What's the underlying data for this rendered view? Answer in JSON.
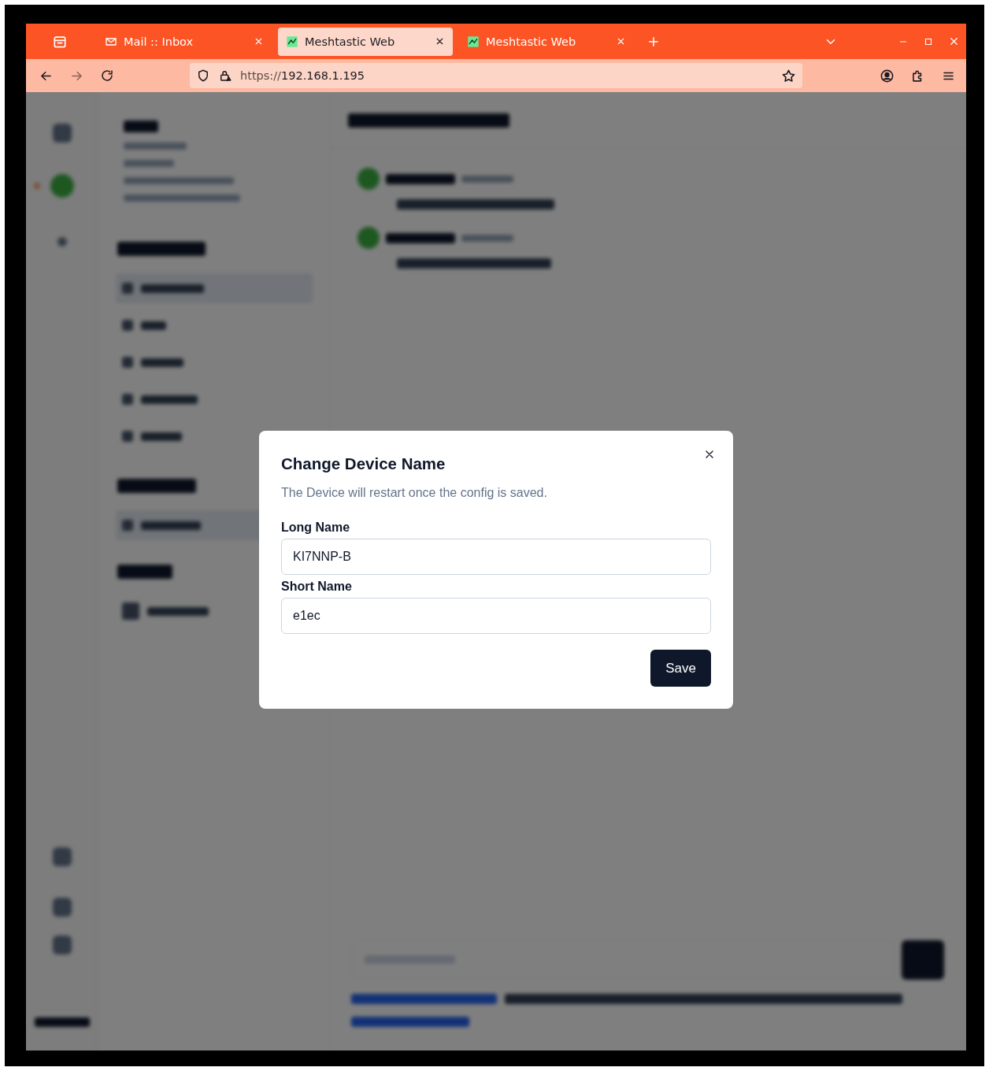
{
  "browser": {
    "tabs": [
      {
        "kind": "mail",
        "title": "Mail :: Inbox",
        "selected": false
      },
      {
        "kind": "app",
        "title": "Meshtastic Web",
        "selected": true
      },
      {
        "kind": "app",
        "title": "Meshtastic Web",
        "selected": false
      }
    ],
    "url_scheme": "https://",
    "url_host": "192.168.1.195"
  },
  "dialog": {
    "title": "Change Device Name",
    "description": "The Device will restart once the config is saved.",
    "fields": [
      {
        "label": "Long Name",
        "value": "KI7NNP-B"
      },
      {
        "label": "Short Name",
        "value": "e1ec"
      }
    ],
    "save": "Save"
  }
}
